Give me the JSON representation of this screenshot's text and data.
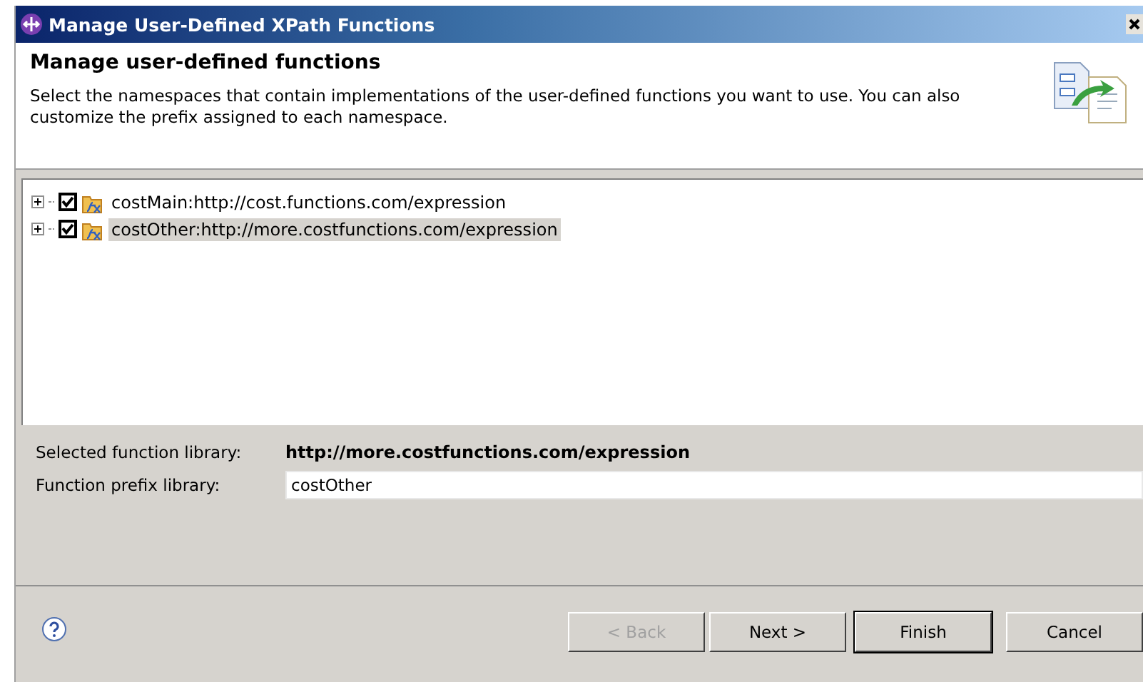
{
  "window": {
    "title": "Manage User-Defined XPath Functions"
  },
  "header": {
    "title": "Manage user-defined functions",
    "description": "Select the namespaces that contain implementations of the user-defined functions you want to use. You can also customize the prefix assigned to each namespace."
  },
  "tree": {
    "items": [
      {
        "label": "costMain:http://cost.functions.com/expression",
        "checked": true,
        "expanded": false,
        "selected": false
      },
      {
        "label": "costOther:http://more.costfunctions.com/expression",
        "checked": true,
        "expanded": false,
        "selected": true
      }
    ]
  },
  "selected_library": {
    "label": "Selected function library:",
    "value": "http://more.costfunctions.com/expression"
  },
  "prefix": {
    "label": "Function prefix library:",
    "value": "costOther"
  },
  "buttons": [
    {
      "label": "< Back",
      "disabled": true,
      "default": false
    },
    {
      "label": "Next >",
      "disabled": false,
      "default": false
    },
    {
      "label": "Finish",
      "disabled": false,
      "default": true
    },
    {
      "label": "Cancel",
      "disabled": false,
      "default": false
    }
  ]
}
